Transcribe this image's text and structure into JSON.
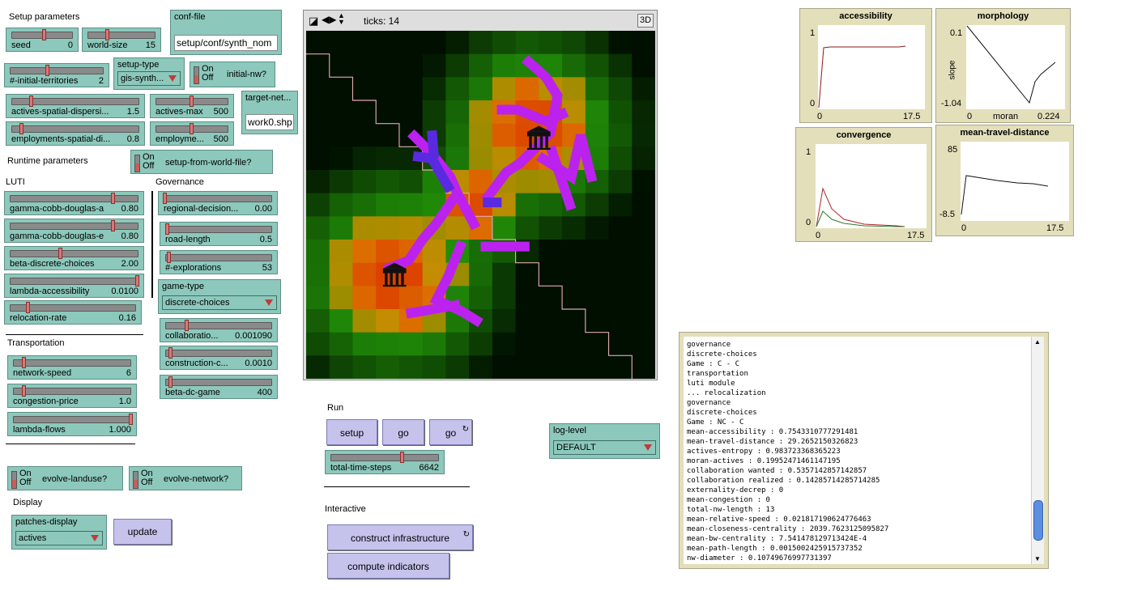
{
  "setup": {
    "section_title": "Setup parameters",
    "seed": {
      "name": "seed",
      "value": "0",
      "level": 0.5
    },
    "world_size": {
      "name": "world-size",
      "value": "15",
      "level": 0.25
    },
    "conf_file": {
      "name": "conf-file",
      "value": "setup/conf/synth_nom"
    },
    "initial_territories": {
      "name": "#-initial-territories",
      "value": "2",
      "level": 0.45
    },
    "setup_type": {
      "name": "setup-type",
      "value": "gis-synth..."
    },
    "initial_nw": {
      "name": "initial-nw?",
      "on": "On",
      "off": "Off"
    },
    "actives_spatial_dispersion": {
      "name": "actives-spatial-dispersi...",
      "value": "1.5",
      "level": 0.15
    },
    "actives_max": {
      "name": "actives-max",
      "value": "500",
      "level": 0.5
    },
    "target_network": {
      "name": "target-net...",
      "value": "work0.shp"
    },
    "employments_spatial": {
      "name": "employments-spatial-di...",
      "value": "0.8",
      "level": 0.08
    },
    "employments_max": {
      "name": "employme...",
      "value": "500",
      "level": 0.5
    }
  },
  "runtime": {
    "section_title": "Runtime parameters",
    "setup_from_world_file": {
      "name": "setup-from-world-file?",
      "on": "On",
      "off": "Off"
    },
    "luti_title": "LUTI",
    "governance_title": "Governance",
    "gamma_a": {
      "name": "gamma-cobb-douglas-a",
      "value": "0.80",
      "level": 0.8
    },
    "gamma_e": {
      "name": "gamma-cobb-douglas-e",
      "value": "0.80",
      "level": 0.8
    },
    "beta_discrete": {
      "name": "beta-discrete-choices",
      "value": "2.00",
      "level": 0.4
    },
    "lambda_accessibility": {
      "name": "lambda-accessibility",
      "value": "0.0100",
      "level": 1.0
    },
    "relocation_rate": {
      "name": "relocation-rate",
      "value": "0.16",
      "level": 0.16
    },
    "regional_decision": {
      "name": "regional-decision...",
      "value": "0.00",
      "level": 0.0
    },
    "road_length": {
      "name": "road-length",
      "value": "0.5",
      "level": 0.02
    },
    "explorations": {
      "name": "#-explorations",
      "value": "53",
      "level": 0.05
    },
    "game_type": {
      "name": "game-type",
      "value": "discrete-choices"
    },
    "collaboration": {
      "name": "collaboratio...",
      "value": "0.001090",
      "level": 0.2
    },
    "construction_cost": {
      "name": "construction-c...",
      "value": "0.0010",
      "level": 0.05
    },
    "beta_dc_game": {
      "name": "beta-dc-game",
      "value": "400",
      "level": 0.05
    }
  },
  "transportation": {
    "section_title": "Transportation",
    "network_speed": {
      "name": "network-speed",
      "value": "6",
      "level": 0.08
    },
    "congestion_price": {
      "name": "congestion-price",
      "value": "1.0",
      "level": 0.08
    },
    "lambda_flows": {
      "name": "lambda-flows",
      "value": "1.000",
      "level": 1.0
    }
  },
  "switches": {
    "evolve_landuse": {
      "name": "evolve-landuse?",
      "on": "On",
      "off": "Off"
    },
    "evolve_network": {
      "name": "evolve-network?",
      "on": "On",
      "off": "Off"
    }
  },
  "display": {
    "section_title": "Display",
    "patches_display": {
      "name": "patches-display",
      "value": "actives"
    },
    "update_label": "update"
  },
  "world": {
    "ticks_label": "ticks: 14",
    "three_d_label": "3D"
  },
  "run": {
    "section_title": "Run",
    "setup_label": "setup",
    "go_label": "go",
    "go_forever_label": "go",
    "forever_icon": "↻",
    "total_time_steps": {
      "name": "total-time-steps",
      "value": "6642",
      "level": 0.66
    }
  },
  "interactive": {
    "section_title": "Interactive",
    "construct_label": "construct infrastructure",
    "compute_label": "compute indicators"
  },
  "log_level": {
    "name": "log-level",
    "value": "DEFAULT"
  },
  "plots": {
    "accessibility": {
      "title": "accessibility",
      "ymax": "1",
      "ymin": "0",
      "xmin": "0",
      "xmax": "17.5"
    },
    "morphology": {
      "title": "morphology",
      "ymax": "0.1",
      "ymin": "-1.04",
      "xmin": "0",
      "xmax": "0.224",
      "xlabel": "moran",
      "ylabel": "slope"
    },
    "convergence": {
      "title": "convergence",
      "ymax": "1",
      "ymin": "0",
      "xmin": "0",
      "xmax": "17.5"
    },
    "mean_travel_distance": {
      "title": "mean-travel-distance",
      "ymax": "85",
      "ymin": "-8.5",
      "xmin": "0",
      "xmax": "17.5"
    }
  },
  "output_lines": [
    "governance",
    "discrete-choices",
    "Game : C - C",
    "transportation",
    "luti module",
    "... relocalization",
    "governance",
    "discrete-choices",
    "Game : NC - C",
    "mean-accessibility : 0.7543310777291481",
    "mean-travel-distance : 29.2652150326823",
    "actives-entropy : 0.983723368365223",
    "moran-actives : 0.19952471461147195",
    "collaboration wanted : 0.5357142857142857",
    "collaboration realized : 0.14285714285714285",
    "externality-decrep : 0",
    "mean-congestion : 0",
    "total-nw-length : 13",
    "mean-relative-speed : 0.021817190624776463",
    "mean-closeness-centrality : 2039.7623125095827",
    "mean-bw-centrality : 7.541478129713424E-4",
    "mean-path-length : 0.0015002425915737352",
    "nw-diameter : 0.10749676997731397"
  ],
  "icons": {
    "edit": "edit-icon",
    "move": "move-icon",
    "scroll_up": "▲",
    "scroll_down": "▼"
  },
  "colors": {
    "widget_green": "#8cc8bb",
    "button_purple": "#c5c3ec",
    "plot_bg": "#e3dfba",
    "road": "#bb22ee",
    "road_alt": "#5a2ae0"
  }
}
